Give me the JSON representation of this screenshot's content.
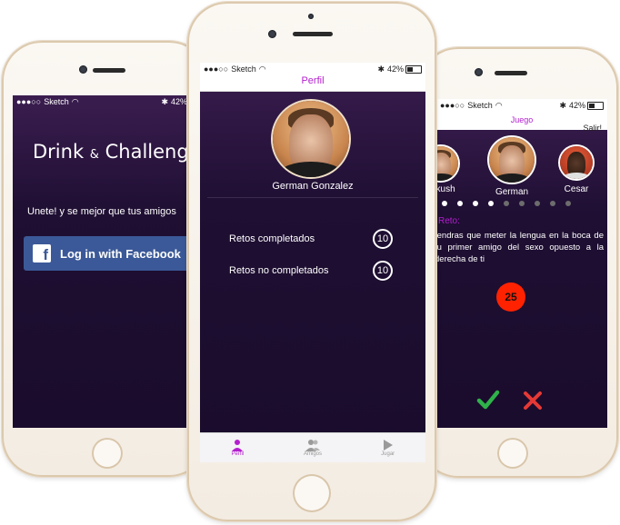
{
  "status": {
    "carrier": "Sketch",
    "battery": "42%"
  },
  "left_screen": {
    "title_part1": "Drink",
    "title_amp": "&",
    "title_part2": "Challenge",
    "subtitle": "Unete! y se mejor que tus amigos",
    "facebook_button": "Log in with Facebook"
  },
  "center_screen": {
    "nav_title": "Perfil",
    "user_name": "German Gonzalez",
    "stats": [
      {
        "label": "Retos completados",
        "value": "10"
      },
      {
        "label": "Retos no completados",
        "value": "10"
      }
    ],
    "tabs": [
      {
        "label": "Perfil"
      },
      {
        "label": "Amigos"
      },
      {
        "label": "Jugar"
      }
    ]
  },
  "right_screen": {
    "nav_title": "Juego",
    "exit_label": "Salir!",
    "players": [
      {
        "name": "nkush"
      },
      {
        "name": "German"
      },
      {
        "name": "Cesar"
      }
    ],
    "challenge_label": "Reto:",
    "challenge_text": "tendras que meter la lengua en la boca de tu primer amigo del sexo opuesto a la derecha de ti",
    "timer": "25"
  },
  "colors": {
    "accent": "#b31fcf",
    "facebook": "#3b5998",
    "accept": "#2fb24a",
    "reject": "#e53935",
    "timer": "#ff2200"
  }
}
